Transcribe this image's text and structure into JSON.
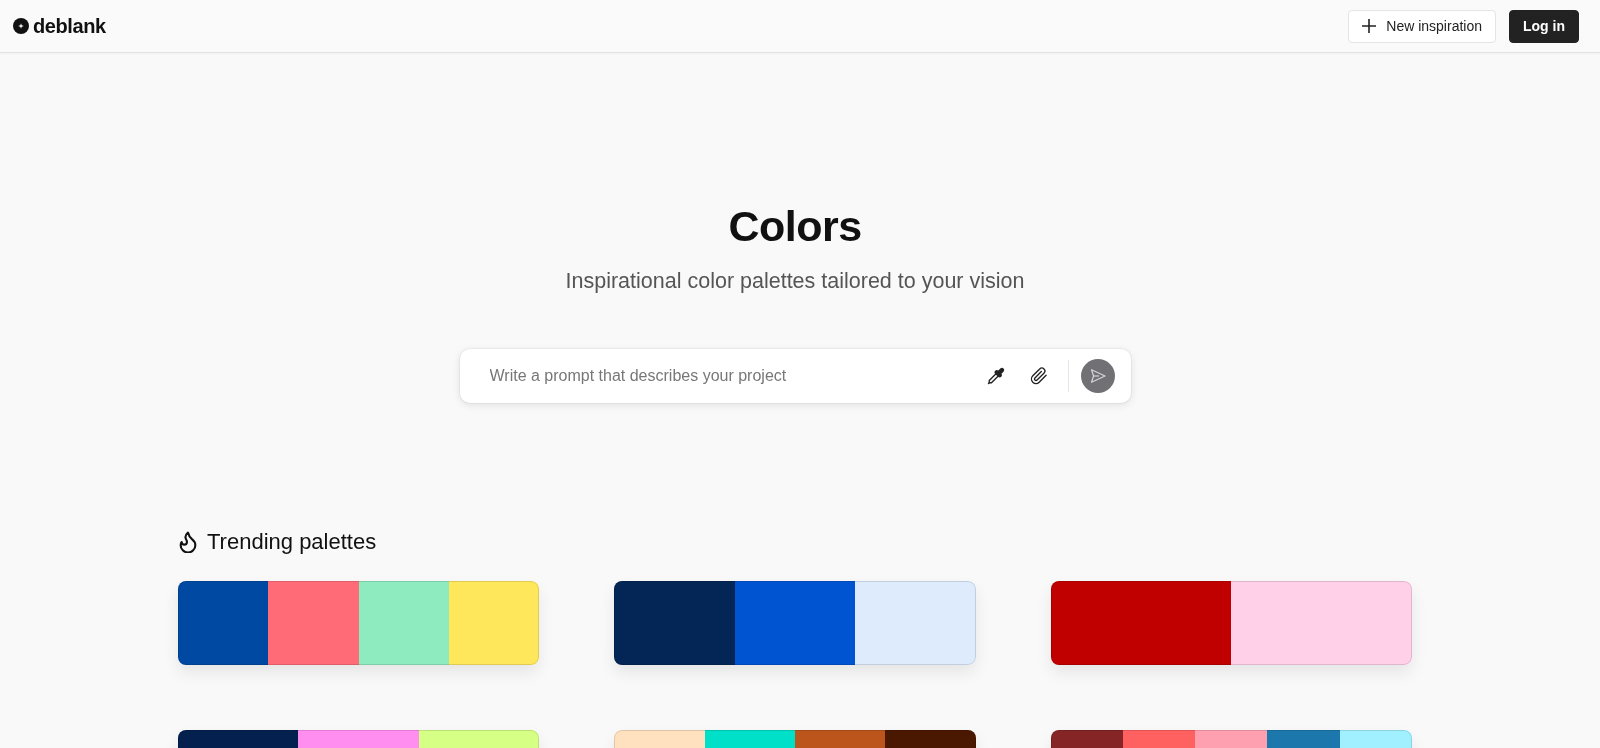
{
  "header": {
    "logo": "deblank",
    "buttons": [
      {
        "label": "New inspiration",
        "kind": "outline"
      },
      {
        "label": "Log in",
        "kind": "primary"
      }
    ]
  },
  "hero": {
    "title": "Colors",
    "subtitle": "Inspirational color palettes tailored to your vision"
  },
  "prompt": {
    "placeholder": "Write a prompt that describes your project"
  },
  "trending": {
    "heading": "Trending palettes",
    "palettes": [
      {
        "swatches": [
          {
            "color": "#0049a3"
          },
          {
            "color": "#ff6b76"
          },
          {
            "color": "#8eeabf"
          },
          {
            "color": "#ffe75c"
          }
        ]
      },
      {
        "swatches": [
          {
            "color": "#042656"
          },
          {
            "color": "#0054d1"
          },
          {
            "color": "#ddebfd"
          }
        ]
      },
      {
        "swatches": [
          {
            "color": "#c00000"
          },
          {
            "color": "#ffd0e8"
          }
        ]
      },
      {
        "swatches": [
          {
            "color": "#03204f"
          },
          {
            "color": "#ff8ef0"
          },
          {
            "color": "#d6ff85"
          }
        ]
      },
      {
        "swatches": [
          {
            "color": "#ffe1c0"
          },
          {
            "color": "#00dfc8"
          },
          {
            "color": "#bb551b"
          },
          {
            "color": "#4a1800"
          }
        ]
      },
      {
        "swatches": [
          {
            "color": "#862525"
          },
          {
            "color": "#ff6060"
          },
          {
            "color": "#ffa0b0"
          },
          {
            "color": "#1c78ac"
          },
          {
            "color": "#a0f0ff"
          }
        ]
      }
    ]
  }
}
